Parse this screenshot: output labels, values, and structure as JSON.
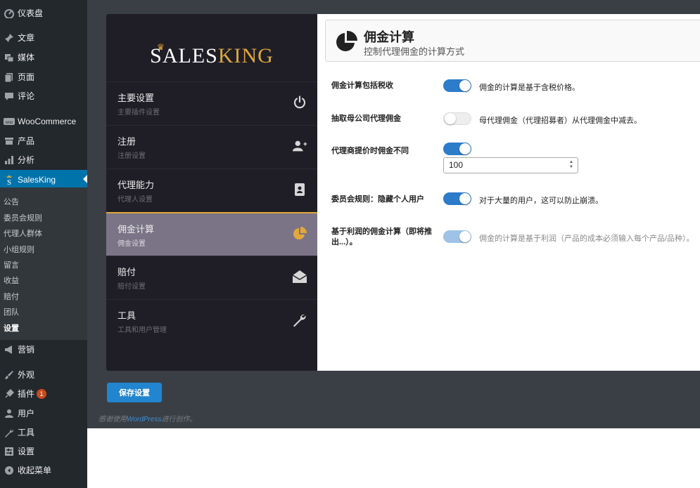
{
  "admin_menu": [
    {
      "key": "dashboard",
      "label": "仪表盘",
      "icon": "dashboard-icon"
    },
    {
      "key": "posts",
      "label": "文章",
      "icon": "pin-icon"
    },
    {
      "key": "media",
      "label": "媒体",
      "icon": "media-icon"
    },
    {
      "key": "pages",
      "label": "页面",
      "icon": "page-icon"
    },
    {
      "key": "comments",
      "label": "评论",
      "icon": "comment-icon"
    },
    {
      "key": "woocommerce",
      "label": "WooCommerce",
      "icon": "woo-icon"
    },
    {
      "key": "products",
      "label": "产品",
      "icon": "archive-icon"
    },
    {
      "key": "analytics",
      "label": "分析",
      "icon": "bar-chart-icon"
    },
    {
      "key": "salesking",
      "label": "SalesKing",
      "icon": "salesking-icon",
      "current": true
    },
    {
      "key": "marketing",
      "label": "营销",
      "icon": "megaphone-icon"
    },
    {
      "key": "appearance",
      "label": "外观",
      "icon": "brush-icon"
    },
    {
      "key": "plugins",
      "label": "插件",
      "icon": "plugin-icon",
      "badge": "1"
    },
    {
      "key": "users",
      "label": "用户",
      "icon": "user-icon"
    },
    {
      "key": "tools",
      "label": "工具",
      "icon": "wrench-icon"
    },
    {
      "key": "settings",
      "label": "设置",
      "icon": "settings-icon"
    },
    {
      "key": "collapse",
      "label": "收起菜单",
      "icon": "collapse-icon"
    }
  ],
  "submenu": [
    "公告",
    "委员会规则",
    "代理人群体",
    "小组规则",
    "留言",
    "收益",
    "赔付",
    "团队",
    "设置"
  ],
  "submenu_current": "设置",
  "brand": {
    "logo_sales": "SALES",
    "logo_king": "KING",
    "accent_color": "#e2a839",
    "primary_color": "#2d7cc9"
  },
  "nav": [
    {
      "title": "主要设置",
      "sub": "主要插件设置",
      "icon": "power-icon"
    },
    {
      "title": "注册",
      "sub": "注册设置",
      "icon": "user-add-icon"
    },
    {
      "title": "代理能力",
      "sub": "代理人设置",
      "icon": "id-card-icon"
    },
    {
      "title": "佣金计算",
      "sub": "佣金设置",
      "icon": "pie-chart-icon",
      "active": true
    },
    {
      "title": "赔付",
      "sub": "赔付设置",
      "icon": "envelope-open-icon"
    },
    {
      "title": "工具",
      "sub": "工具和用户管理",
      "icon": "wrench-icon"
    }
  ],
  "header": {
    "title": "佣金计算",
    "subtitle": "控制代理佣金的计算方式",
    "icon": "pie-chart-icon"
  },
  "settings": [
    {
      "label": "佣金计算包括税收",
      "enabled": true,
      "description": "佣金的计算是基于含税价格。"
    },
    {
      "label": "抽取母公司代理佣金",
      "enabled": false,
      "description": "母代理佣金（代理招募者）从代理佣金中减去。"
    },
    {
      "label": "代理商提价时佣金不同",
      "enabled": true,
      "description": "",
      "input_value": "100"
    },
    {
      "label": "委员会规则：隐藏个人用户",
      "enabled": true,
      "description": "对于大量的用户，这可以防止崩溃。"
    },
    {
      "label": "基于利润的佣金计算（即将推出...）。",
      "enabled": true,
      "disabled": true,
      "description": "佣金的计算是基于利润（产品的成本必须输入每个产品/品种）。"
    }
  ],
  "save_label": "保存设置",
  "footer": {
    "prefix": "感谢使用",
    "link": "WordPress",
    "suffix": "进行创作。"
  }
}
